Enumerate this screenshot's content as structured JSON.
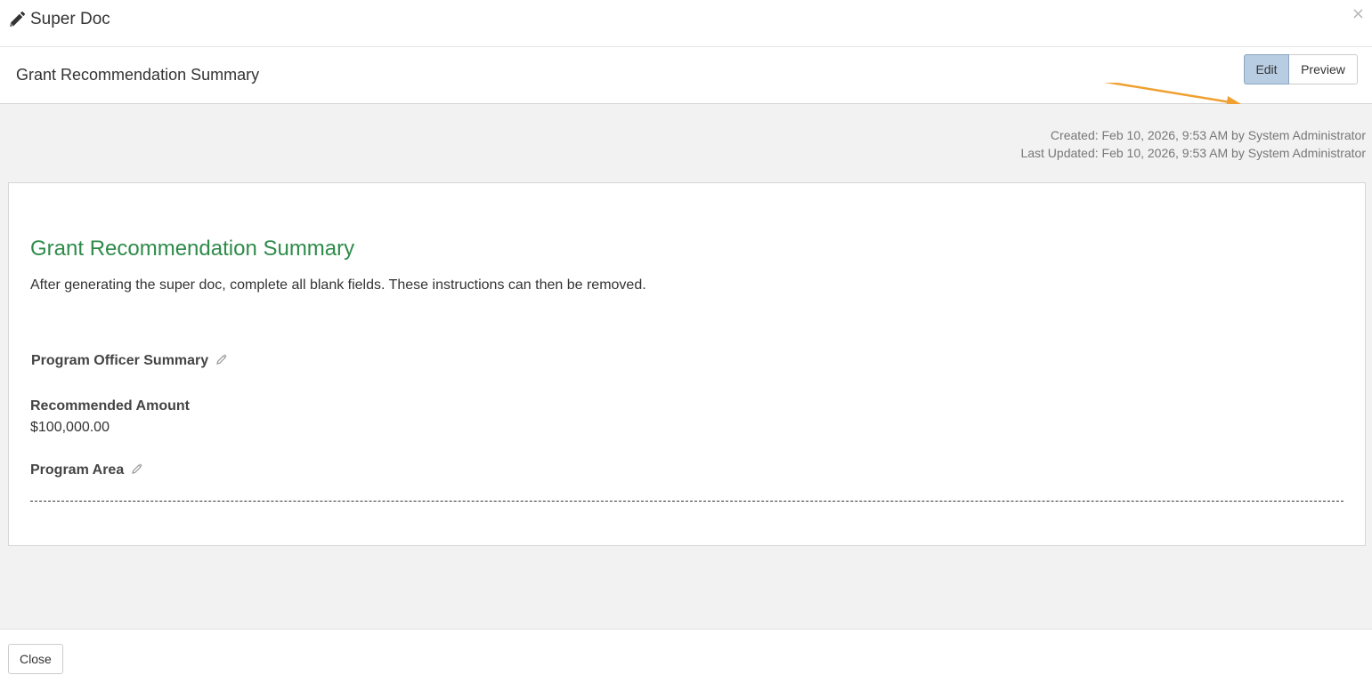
{
  "modal": {
    "title": "Super Doc",
    "close_glyph": "×",
    "title_icon": "pencil-icon"
  },
  "doc_bar": {
    "title": "Grant Recommendation Summary",
    "edit_label": "Edit",
    "preview_label": "Preview",
    "active_mode": "Edit",
    "annotation_color": "#f0a030"
  },
  "meta": {
    "created": "Created: Feb 10, 2026, 9:53 AM by System Administrator",
    "last_updated": "Last Updated: Feb 10, 2026, 9:53 AM by System Administrator"
  },
  "document": {
    "heading": "Grant Recommendation Summary",
    "heading_color": "#2e8b4a",
    "instructions": "After generating the super doc, complete all blank fields. These instructions can then be removed.",
    "fields": {
      "program_officer_summary": {
        "label": "Program Officer Summary",
        "icon": "pencil-icon"
      },
      "recommended_amount": {
        "label": "Recommended Amount",
        "value": "$100,000.00"
      },
      "program_area": {
        "label": "Program Area",
        "icon": "pencil-icon"
      }
    }
  },
  "footer": {
    "close_label": "Close"
  }
}
